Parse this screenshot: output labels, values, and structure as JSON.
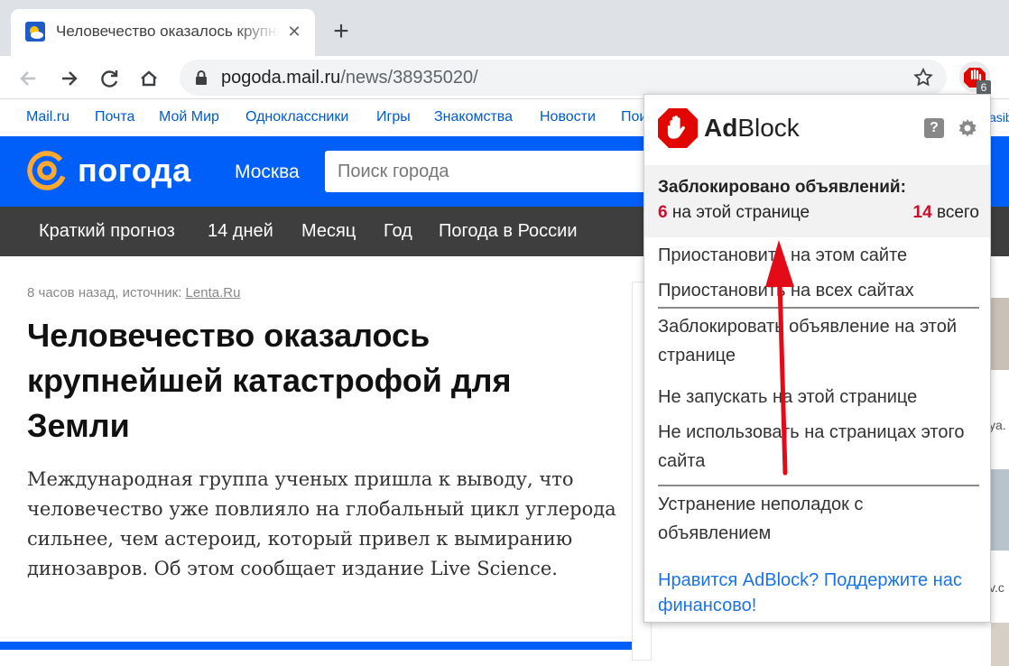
{
  "browser": {
    "tab_title": "Человечество оказалось крупнейшей катастрофой для Земли",
    "url_host": "pogoda.mail.ru",
    "url_path": "/news/38935020/",
    "extension_badge": "6"
  },
  "mailru_links": [
    "Mail.ru",
    "Почта",
    "Мой Мир",
    "Одноклассники",
    "Игры",
    "Знакомства",
    "Новости",
    "Пои"
  ],
  "header": {
    "logo_text": "погода",
    "city": "Москва",
    "search_placeholder": "Поиск города"
  },
  "nav": [
    "Краткий прогноз",
    "14 дней",
    "Месяц",
    "Год",
    "Погода в России"
  ],
  "article": {
    "meta_prefix": "8 часов назад, источник: ",
    "source": "Lenta.Ru",
    "headline": "Человечество оказалось крупнейшей катастрофой для Земли",
    "lead": "Международная группа ученых пришла к выводу, что человечество уже повлияло на глобальный цикл углерода сильнее, чем астероид, который привел к вымиранию динозавров. Об этом сообщает издание Live Science."
  },
  "side_fragments": [
    "asib",
    "ya.",
    "v.c"
  ],
  "adblock": {
    "name_bold": "Ad",
    "name_rest": "Block",
    "help_label": "?",
    "stats_title": "Заблокировано объявлений:",
    "page_count": "6",
    "page_label": " на этой странице",
    "total_count": "14",
    "total_label": " всего",
    "menu": {
      "pause_site": "Приостановить на этом сайте",
      "pause_all": "Приостановить на всех сайтах",
      "block_ad_1": "Заблокировать объявление на этой",
      "block_ad_2": "странице",
      "dont_run": "Не запускать на этой странице",
      "dont_use_1": "Не использовать на страницах этого",
      "dont_use_2": "сайта",
      "troubleshoot_1": "Устранение неполадок с",
      "troubleshoot_2": "объявлением"
    },
    "support_link": "Нравится AdBlock? Поддержите нас финансово!"
  },
  "colors": {
    "mail_blue": "#005ff9",
    "adblock_red": "#c8102e",
    "link_blue": "#1a73e8"
  }
}
